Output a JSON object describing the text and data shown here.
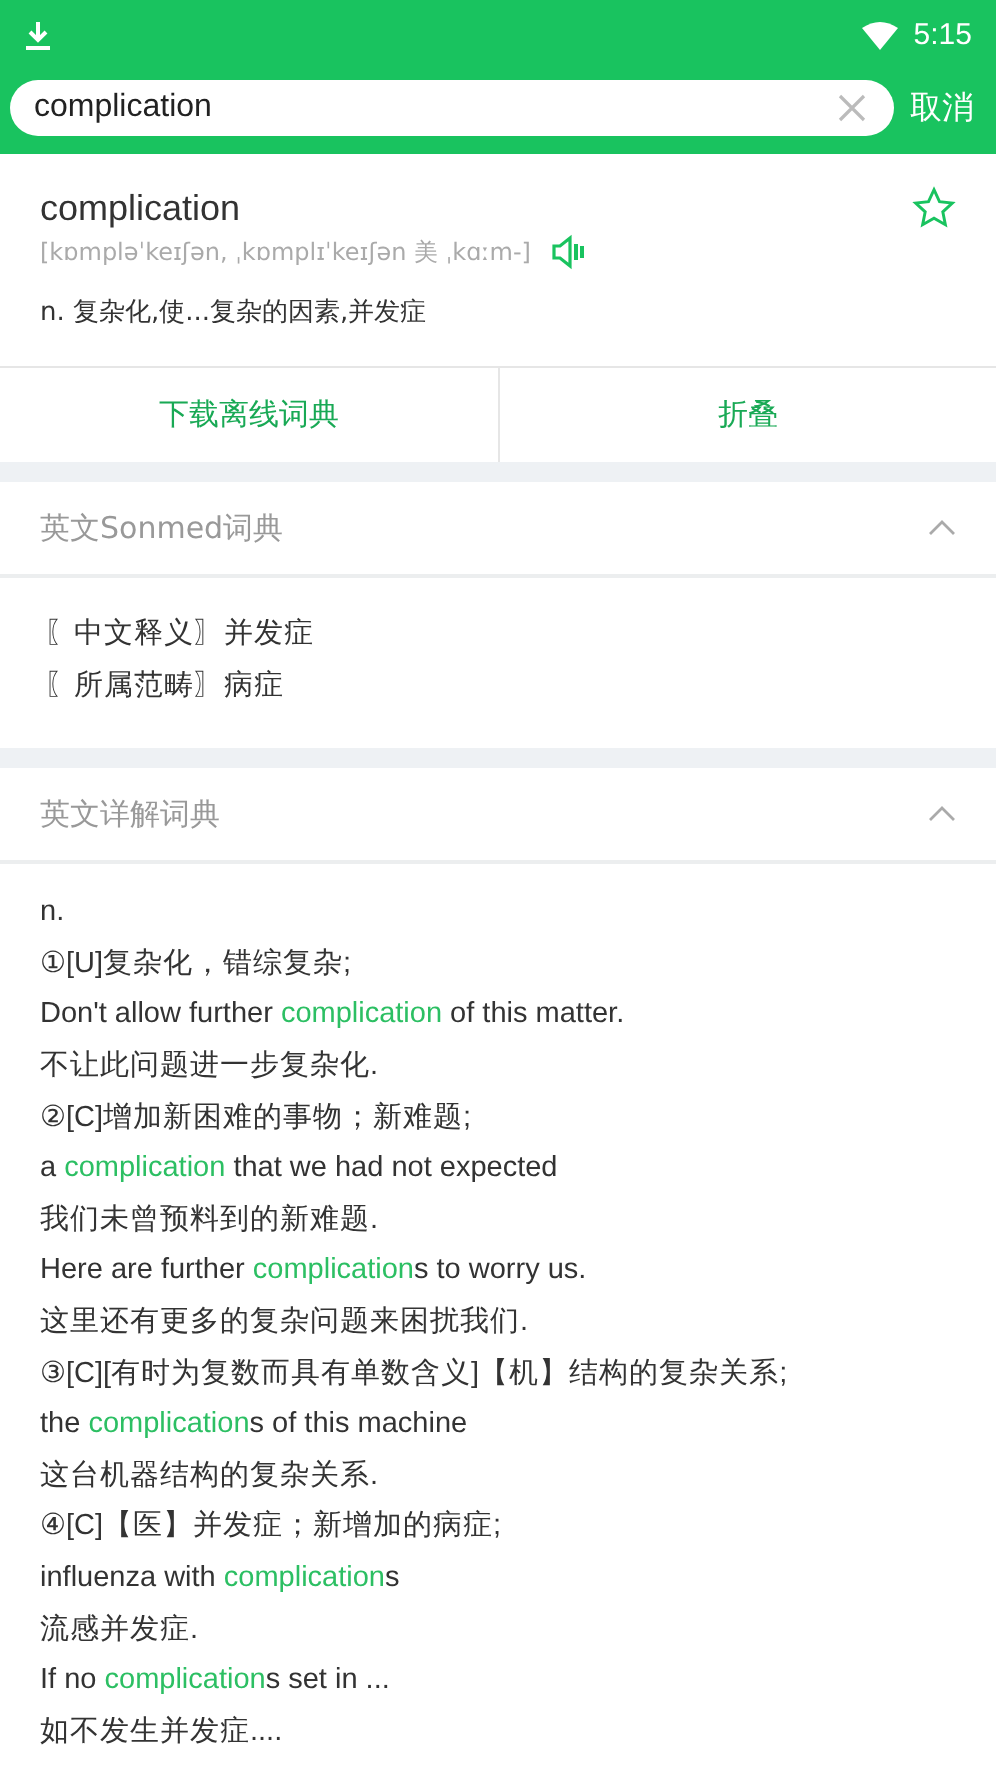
{
  "status_bar": {
    "time": "5:15"
  },
  "search": {
    "value": "complication",
    "cancel": "取消"
  },
  "entry": {
    "word": "complication",
    "phonetic": "[kɒmpləˈkeɪʃən, ˌkɒmplɪˈkeɪʃən 美 ˌkɑːm-]",
    "definition": "n. 复杂化,使...复杂的因素,并发症",
    "starred": false
  },
  "actions": [
    "下载离线词典",
    "折叠"
  ],
  "sections": [
    {
      "title": "英文Sonmed词典",
      "expanded": true,
      "kind": "simple",
      "lines": [
        [
          {
            "text": "〖中文释义〗并发症",
            "highlight": false
          }
        ],
        [
          {
            "text": "〖所属范畴〗病症",
            "highlight": false
          }
        ]
      ]
    },
    {
      "title": "英文详解词典",
      "expanded": true,
      "kind": "detail",
      "lines": [
        [
          {
            "text": "n.",
            "highlight": false
          }
        ],
        [
          {
            "text": "①[U]复杂化，错综复杂;",
            "highlight": false
          }
        ],
        [
          {
            "text": "Don't allow further ",
            "highlight": false
          },
          {
            "text": "complication",
            "highlight": true
          },
          {
            "text": " of this matter.",
            "highlight": false
          }
        ],
        [
          {
            "text": "不让此问题进一步复杂化.",
            "highlight": false
          }
        ],
        [
          {
            "text": "②[C]增加新困难的事物；新难题;",
            "highlight": false
          }
        ],
        [
          {
            "text": "a ",
            "highlight": false
          },
          {
            "text": "complication",
            "highlight": true
          },
          {
            "text": " that we had not expected",
            "highlight": false
          }
        ],
        [
          {
            "text": "我们未曾预料到的新难题.",
            "highlight": false
          }
        ],
        [
          {
            "text": "Here are further ",
            "highlight": false
          },
          {
            "text": "complication",
            "highlight": true
          },
          {
            "text": "s to worry us.",
            "highlight": false
          }
        ],
        [
          {
            "text": "这里还有更多的复杂问题来困扰我们.",
            "highlight": false
          }
        ],
        [
          {
            "text": "③[C][有时为复数而具有单数含义]【机】结构的复杂关系;",
            "highlight": false
          }
        ],
        [
          {
            "text": "the ",
            "highlight": false
          },
          {
            "text": "complication",
            "highlight": true
          },
          {
            "text": "s of this machine",
            "highlight": false
          }
        ],
        [
          {
            "text": "这台机器结构的复杂关系.",
            "highlight": false
          }
        ],
        [
          {
            "text": "④[C]【医】并发症；新增加的病症;",
            "highlight": false
          }
        ],
        [
          {
            "text": "influenza with ",
            "highlight": false
          },
          {
            "text": "complication",
            "highlight": true
          },
          {
            "text": "s",
            "highlight": false
          }
        ],
        [
          {
            "text": "流感并发症.",
            "highlight": false
          }
        ],
        [
          {
            "text": "If no ",
            "highlight": false
          },
          {
            "text": "complication",
            "highlight": true
          },
          {
            "text": "s set in ...",
            "highlight": false
          }
        ],
        [
          {
            "text": "如不发生并发症....",
            "highlight": false
          }
        ]
      ]
    }
  ]
}
